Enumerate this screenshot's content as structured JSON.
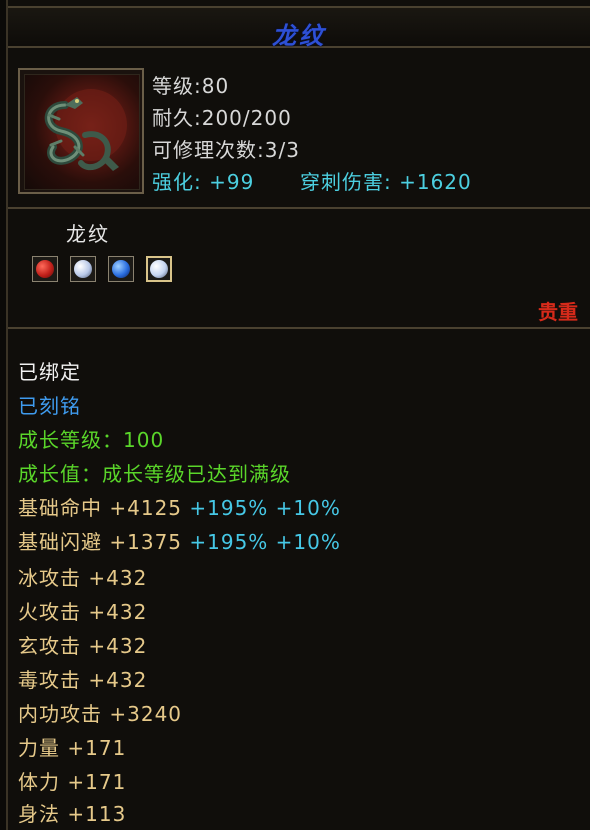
{
  "header": {
    "title": "龙纹"
  },
  "summary": {
    "level": "等级:80",
    "durability": "耐久:200/200",
    "repairs": "可修理次数:3/3",
    "enhance": "强化: +99",
    "pierce": "穿刺伤害: +1620"
  },
  "item": {
    "name": "龙纹",
    "gems": [
      {
        "icon": "red-gem-icon",
        "color": "#c0201a"
      },
      {
        "icon": "silver-gem-icon",
        "color": "#b8c8e8"
      },
      {
        "icon": "blue-gem-icon",
        "color": "#2a6ee0"
      },
      {
        "icon": "silver-gem-icon",
        "color": "#c4d4f0"
      }
    ],
    "rarity": "贵重"
  },
  "attributes": {
    "bound": "已绑定",
    "engraved": "已刻铭",
    "growth_level": "成长等级：100",
    "growth_value": "成长值：成长等级已达到满级",
    "hit": {
      "label": "基础命中 +4125",
      "bonus": "+195% +10%"
    },
    "dodge": {
      "label": "基础闪避 +1375",
      "bonus": "+195% +10%"
    },
    "ice_attack": "冰攻击 +432",
    "fire_attack": "火攻击 +432",
    "mystic_attack": "玄攻击 +432",
    "poison_attack": "毒攻击 +432",
    "inner_attack": "内功攻击 +3240",
    "strength": "力量 +171",
    "stamina": "体力 +171",
    "agility": "身法 +113"
  },
  "colors": {
    "title_blue": "#2d50d6",
    "cyan": "#4ccfe0",
    "green": "#5ad62a",
    "gold": "#e6c98a",
    "rarity_red": "#d62a1a",
    "engraved_blue": "#3f9bee"
  }
}
